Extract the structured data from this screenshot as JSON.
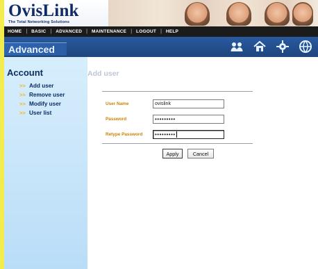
{
  "brand": {
    "name": "OvisLink",
    "tagline": "The Total Networking Solutions"
  },
  "topnav": {
    "items": [
      "HOME",
      "BASIC",
      "ADVANCED",
      "MAINTENANCE",
      "LOGOUT",
      "HELP"
    ],
    "separator": "|"
  },
  "section": {
    "title": "Advanced",
    "quick_icons": [
      "user-group-icon",
      "house-icon",
      "gear-icon",
      "globe-icon"
    ]
  },
  "sidebar": {
    "title": "Account",
    "items": [
      {
        "label": "Add user"
      },
      {
        "label": "Remove user"
      },
      {
        "label": "Modify user"
      },
      {
        "label": "User list"
      }
    ],
    "arrow": ">>"
  },
  "main": {
    "page_title": "Add user",
    "form": {
      "username_label": "User Name",
      "username_value": "ovislink",
      "password_label": "Password",
      "password_value": "•••••••••",
      "retype_label": "Retype Password",
      "retype_value": "•••••••••"
    },
    "buttons": {
      "apply": "Apply",
      "cancel": "Cancel"
    }
  },
  "colors": {
    "outer_border": "#f3ec4e",
    "nav_bg": "#1b1b1b",
    "section_bar": "#23508f",
    "sidebar_bg": "#cfe9fb",
    "label_orange": "#c98200",
    "sidebar_text": "#0e2d61"
  }
}
